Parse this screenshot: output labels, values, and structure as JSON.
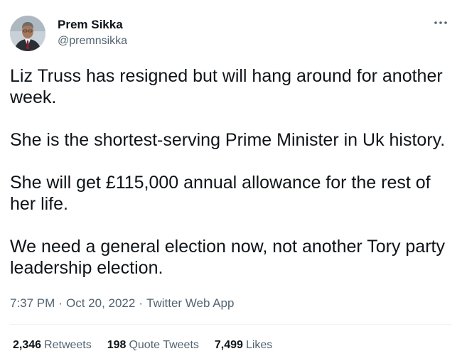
{
  "author": {
    "name": "Prem Sikka",
    "handle": "@premnsikka",
    "avatar_icon": "profile-photo"
  },
  "tweet": {
    "paragraphs": [
      "Liz Truss has resigned but will hang around for another week.",
      "She is the shortest-serving Prime Minister in Uk history.",
      "She will get £115,000 annual allowance for the rest of her life.",
      "We need a general election now, not another Tory party leadership election."
    ]
  },
  "meta": {
    "time": "7:37 PM",
    "separator": "·",
    "date": "Oct 20, 2022",
    "source": "Twitter Web App"
  },
  "stats": {
    "retweets_count": "2,346",
    "retweets_label": "Retweets",
    "quotes_count": "198",
    "quotes_label": "Quote Tweets",
    "likes_count": "7,499",
    "likes_label": "Likes"
  },
  "icons": {
    "more": "more-options-icon"
  },
  "colors": {
    "text_primary": "#0f1419",
    "text_secondary": "#536471",
    "divider": "#eff3f4"
  }
}
